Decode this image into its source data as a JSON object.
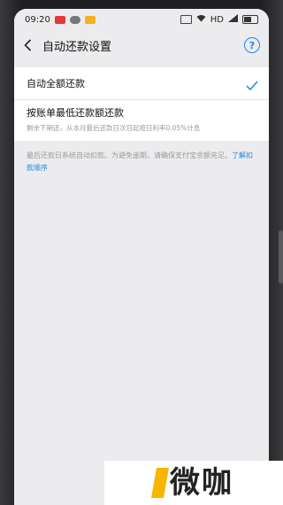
{
  "status_bar": {
    "time": "09:20",
    "network": "HD"
  },
  "nav": {
    "title": "自动还款设置",
    "help_glyph": "?"
  },
  "options": [
    {
      "title": "自动全额还款",
      "selected": true
    },
    {
      "title": "按账单最低还款额还款",
      "description": "剩余下期还，从本月最后还款日次日起按日利率0.05%计息",
      "selected": false
    }
  ],
  "note": {
    "text": "最后还款日系统自动扣款。为避免逾期，请确保支付宝余额充足。",
    "link": "了解扣款顺序"
  },
  "watermark": {
    "text": "微咖"
  },
  "colors": {
    "accent": "#1e87e6",
    "background": "#ececee",
    "watermark_mark": "#f7b500"
  }
}
